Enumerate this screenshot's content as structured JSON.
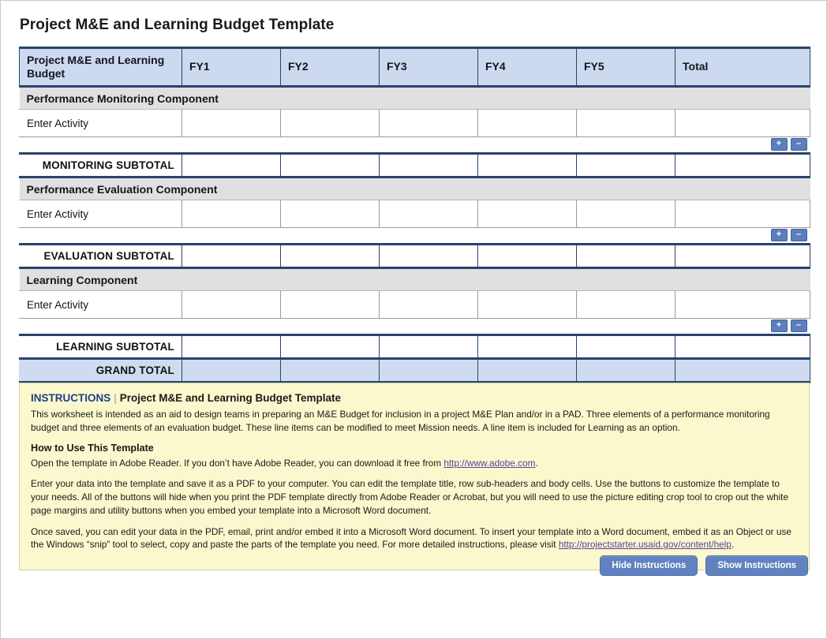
{
  "page_title": "Project M&E and Learning Budget Template",
  "table": {
    "columns": [
      "Project M&E and Learning Budget",
      "FY1",
      "FY2",
      "FY3",
      "FY4",
      "FY5",
      "Total"
    ],
    "sections": [
      {
        "section_label": "Performance Monitoring Component",
        "activity_label": "Enter Activity",
        "subtotal_label": "MONITORING SUBTOTAL"
      },
      {
        "section_label": "Performance Evaluation Component",
        "activity_label": "Enter Activity",
        "subtotal_label": "EVALUATION SUBTOTAL"
      },
      {
        "section_label": "Learning Component",
        "activity_label": "Enter Activity",
        "subtotal_label": "LEARNING SUBTOTAL"
      }
    ],
    "grand_total_label": "GRAND TOTAL",
    "row_tools": {
      "add_label": "+",
      "remove_label": "–"
    }
  },
  "instructions": {
    "keyword": "INSTRUCTIONS",
    "divider": "|",
    "title": "Project M&E and Learning Budget Template",
    "intro": "This worksheet is intended as an aid to design teams in preparing an M&E Budget for inclusion in a project M&E Plan and/or in a PAD. Three elements of a performance monitoring budget and three elements of an evaluation budget. These line items can be modified to meet Mission needs. A line item is included for Learning as an option.",
    "how_to_heading": "How to Use This Template",
    "para1_before_link": "Open the template in Adobe Reader. If you don’t have Adobe Reader, you can download it free from ",
    "para1_link": "http://www.adobe.com",
    "para1_after_link": ".",
    "para2": "Enter your data into the template and save it as a PDF to your computer. You can edit the template title, row sub-headers and body cells. Use the buttons to customize the template to your needs. All of the buttons will hide when you print the PDF template directly from Adobe Reader or Acrobat, but you will need to use the picture editing crop tool to crop out the white page margins and utility buttons when you embed your template into a Microsoft Word document.",
    "para3_before_link": "Once saved, you can edit your data in the PDF, email, print and/or embed it into a Microsoft Word document. To insert your template into a Word document, embed it as an Object or use the Windows “snip” tool to select, copy and paste the parts of the template you need. For more detailed instructions, please visit ",
    "para3_link": "http://projectstarter.usaid.gov/content/help",
    "para3_after_link": "."
  },
  "footer": {
    "hide_label": "Hide Instructions",
    "show_label": "Show Instructions"
  },
  "colors": {
    "header_fill": "#ccd9ef",
    "section_fill": "#e0e0e0",
    "grand_total_fill": "#cfdcf0",
    "rule": "#27436e",
    "instructions_fill": "#fbf8cd",
    "button_blue": "#6182c0",
    "link": "#5b3fa0",
    "keyword_blue": "#1f3f86"
  }
}
